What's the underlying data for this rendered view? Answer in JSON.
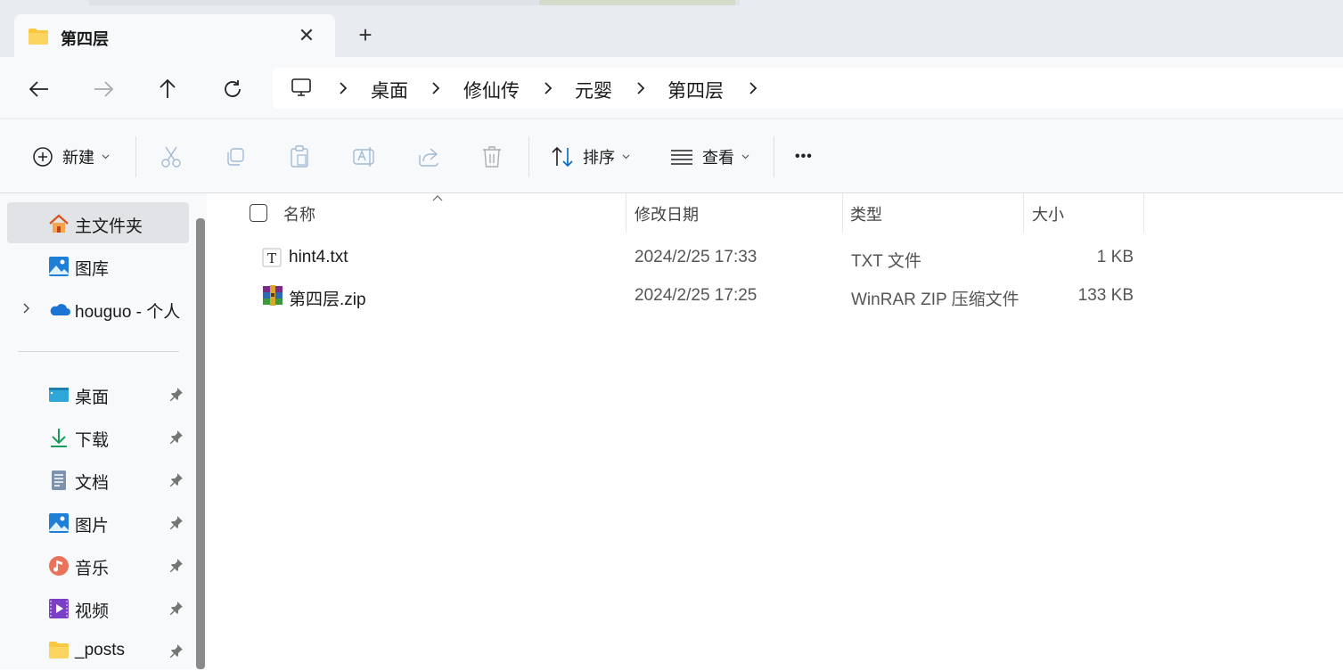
{
  "window": {
    "tab_title": "第四层",
    "close_glyph": "✕",
    "newtab_glyph": "+"
  },
  "breadcrumbs": [
    "桌面",
    "修仙传",
    "元婴",
    "第四层"
  ],
  "toolbar": {
    "new_label": "新建",
    "sort_label": "排序",
    "view_label": "查看",
    "more_glyph": "•••"
  },
  "sidebar": {
    "top_items": [
      {
        "label": "主文件夹",
        "icon": "home-icon"
      },
      {
        "label": "图库",
        "icon": "gallery-icon"
      },
      {
        "label": "houguo - 个人",
        "icon": "onedrive-cloud-icon"
      }
    ],
    "pinned_items": [
      {
        "label": "桌面",
        "icon": "desktop-icon"
      },
      {
        "label": "下载",
        "icon": "download-icon"
      },
      {
        "label": "文档",
        "icon": "document-icon"
      },
      {
        "label": "图片",
        "icon": "pictures-icon"
      },
      {
        "label": "音乐",
        "icon": "music-icon"
      },
      {
        "label": "视频",
        "icon": "video-icon"
      },
      {
        "label": "_posts",
        "icon": "folder-icon"
      }
    ]
  },
  "file_list": {
    "columns": {
      "name": "名称",
      "modified": "修改日期",
      "type": "类型",
      "size": "大小"
    },
    "rows": [
      {
        "name": "hint4.txt",
        "modified": "2024/2/25 17:33",
        "type": "TXT 文件",
        "size": "1 KB",
        "icon": "text-file-icon"
      },
      {
        "name": "第四层.zip",
        "modified": "2024/2/25 17:25",
        "type": "WinRAR ZIP 压缩文件",
        "size": "133 KB",
        "icon": "winrar-archive-icon"
      }
    ]
  },
  "colors": {
    "accent": "#0067c0",
    "folder": "#f8c843",
    "selected_bg": "#e1e3e6"
  }
}
